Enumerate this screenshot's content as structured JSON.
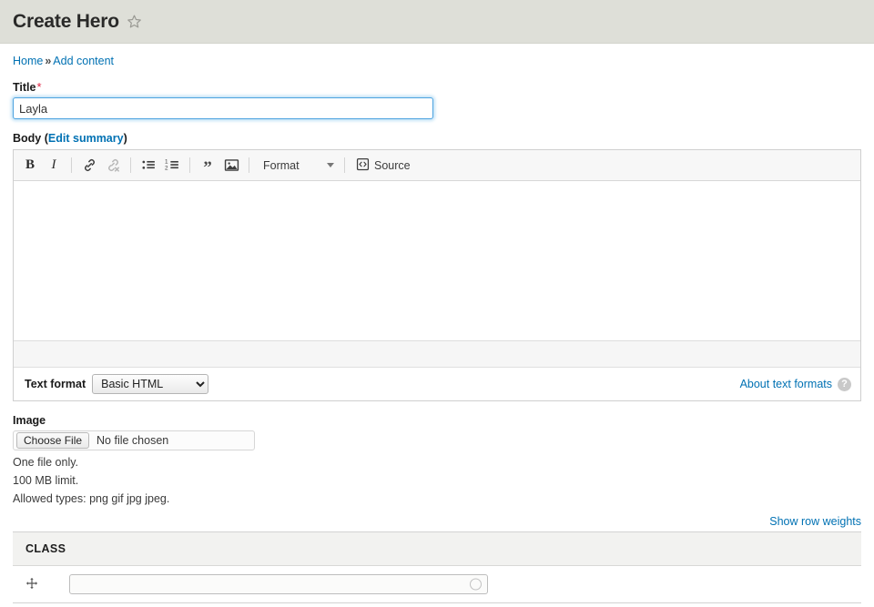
{
  "header": {
    "title": "Create Hero",
    "star_icon": "star-outline-icon"
  },
  "breadcrumb": {
    "home": "Home",
    "separator": "»",
    "current": "Add content"
  },
  "title_field": {
    "label": "Title",
    "required_mark": "*",
    "value": "Layla",
    "placeholder": ""
  },
  "body_field": {
    "label": "Body",
    "open_paren": "(",
    "edit_summary_link": "Edit summary",
    "close_paren": ")",
    "content": "",
    "toolbar": {
      "bold": "B",
      "italic": "I",
      "link_icon": "link-icon",
      "unlink_icon": "unlink-icon",
      "bullet_list_icon": "bullet-list-icon",
      "numbered_list_icon": "numbered-list-icon",
      "blockquote": "”",
      "image_icon": "image-icon",
      "format_label": "Format",
      "source_label": "Source",
      "source_icon": "source-code-icon"
    },
    "text_format": {
      "label": "Text format",
      "selected": "Basic HTML",
      "options": [
        "Basic HTML"
      ],
      "about_link": "About text formats",
      "help_icon": "question-mark-icon"
    }
  },
  "image_field": {
    "label": "Image",
    "choose_button": "Choose File",
    "file_status": "No file chosen",
    "help_lines": [
      "One file only.",
      "100 MB limit.",
      "Allowed types: png gif jpg jpeg."
    ]
  },
  "class_table": {
    "show_row_weights": "Show row weights",
    "columns": [
      "CLASS"
    ],
    "rows": [
      {
        "drag_handle_icon": "drag-move-icon",
        "value": "",
        "placeholder": "",
        "throbber_icon": "autocomplete-throbber-icon"
      }
    ]
  },
  "colors": {
    "header_bg": "#dedfd8",
    "link": "#0071b3",
    "required": "#e02443",
    "focus_ring": "#4ea3e0",
    "table_header_bg": "#f2f2f0"
  }
}
